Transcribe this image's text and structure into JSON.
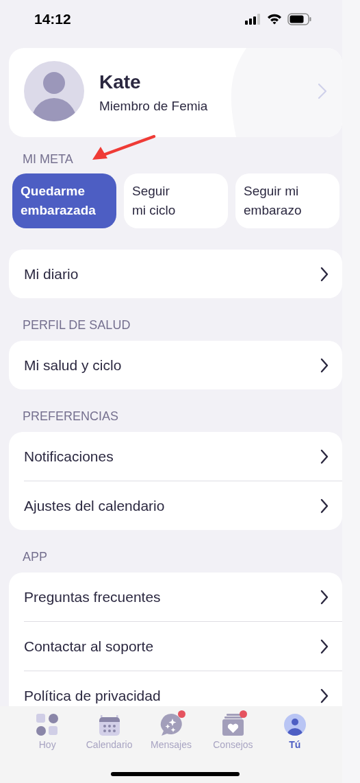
{
  "status_bar": {
    "time": "14:12"
  },
  "profile": {
    "name": "Kate",
    "subtitle": "Miembro de Femia"
  },
  "goal": {
    "heading": "MI META",
    "options": [
      {
        "label": "Quedarme\nembarazada",
        "selected": true
      },
      {
        "label": "Seguir\nmi ciclo",
        "selected": false
      },
      {
        "label": "Seguir mi\nembarazo",
        "selected": false
      }
    ]
  },
  "sections": [
    {
      "rows": [
        "Mi diario"
      ]
    },
    {
      "heading": "PERFIL DE SALUD",
      "rows": [
        "Mi salud y ciclo"
      ]
    },
    {
      "heading": "PREFERENCIAS",
      "rows": [
        "Notificaciones",
        "Ajustes del calendario"
      ]
    },
    {
      "heading": "APP",
      "rows": [
        "Preguntas frecuentes",
        "Contactar al soporte",
        "Política de privacidad"
      ]
    }
  ],
  "tab_bar": [
    {
      "label": "Hoy",
      "selected": false,
      "badge": false
    },
    {
      "label": "Calendario",
      "selected": false,
      "badge": false
    },
    {
      "label": "Mensajes",
      "selected": false,
      "badge": true
    },
    {
      "label": "Consejos",
      "selected": false,
      "badge": true
    },
    {
      "label": "Tú",
      "selected": true,
      "badge": false
    }
  ]
}
